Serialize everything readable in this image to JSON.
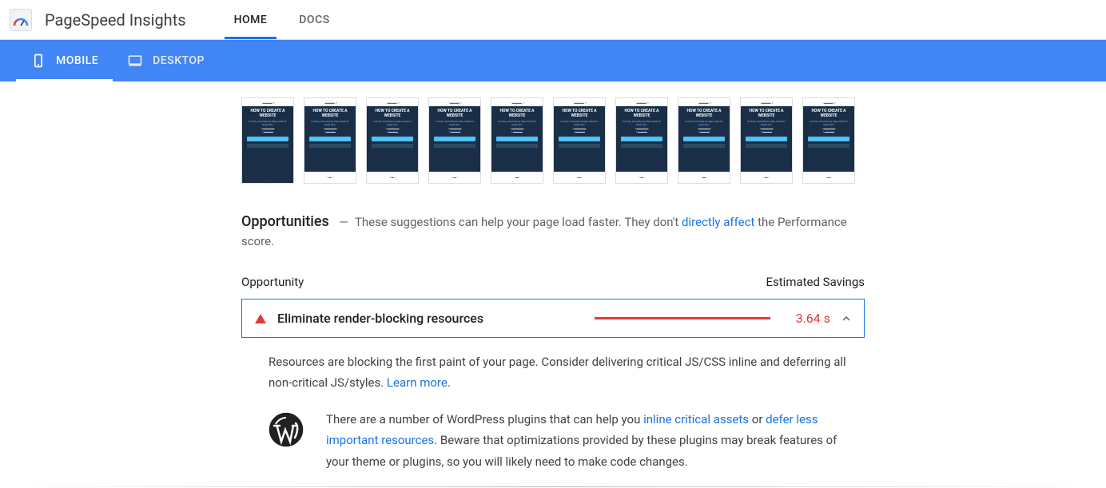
{
  "app": {
    "title": "PageSpeed Insights"
  },
  "topnav": {
    "tabs": [
      {
        "label": "HOME",
        "active": true
      },
      {
        "label": "DOCS",
        "active": false
      }
    ]
  },
  "devices": {
    "tabs": [
      {
        "label": "MOBILE",
        "active": true
      },
      {
        "label": "DESKTOP",
        "active": false
      }
    ]
  },
  "filmstrip": {
    "thumb_title": "HOW TO CREATE A WEBSITE",
    "thumb_subtitle": "An Easy, Free Step by Step Guide for Beginners",
    "count": 10
  },
  "opportunities": {
    "heading": "Opportunities",
    "desc_before": "These suggestions can help your page load faster. They don't ",
    "desc_link": "directly affect",
    "desc_after": " the Performance score.",
    "col_left": "Opportunity",
    "col_right": "Estimated Savings",
    "items": [
      {
        "title": "Eliminate render-blocking resources",
        "savings": "3.64 s"
      }
    ],
    "detail": {
      "text_before": "Resources are blocking the first paint of your page. Consider delivering critical JS/CSS inline and deferring all non-critical JS/styles. ",
      "learn_more": "Learn more",
      "wp_before": "There are a number of WordPress plugins that can help you ",
      "wp_link1": "inline critical assets",
      "wp_mid1": " or ",
      "wp_link2": "defer less important resources",
      "wp_after": ". Beware that optimizations provided by these plugins may break features of your theme or plugins, so you will likely need to make code changes."
    }
  }
}
